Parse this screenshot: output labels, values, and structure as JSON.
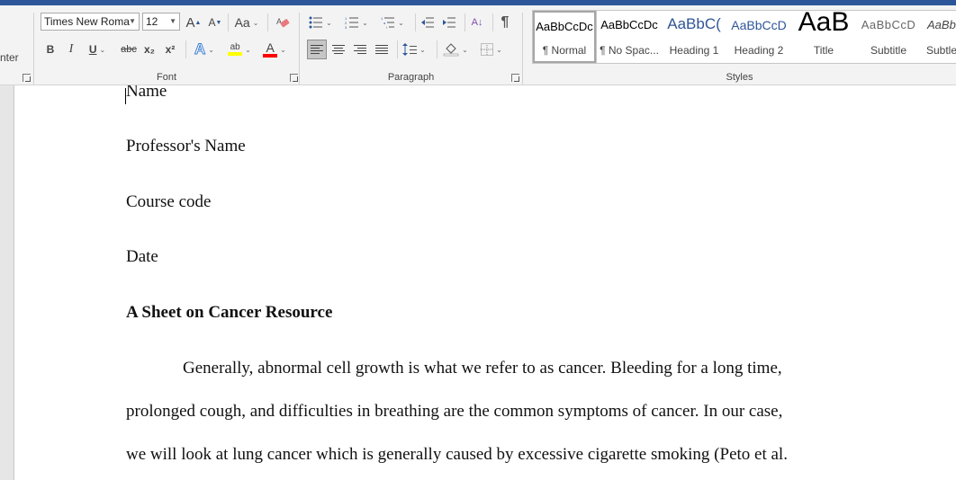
{
  "ribbon": {
    "clipboard": {
      "partial_label": "nter"
    },
    "font": {
      "label": "Font",
      "font_name": "Times New Roma",
      "font_size": "12",
      "grow_font": "A",
      "shrink_font": "A",
      "change_case": "Aa",
      "bold": "B",
      "italic": "I",
      "underline": "U",
      "strikethrough": "abc",
      "subscript": "x₂",
      "superscript": "x²",
      "text_effects": "A",
      "highlight": "ab",
      "font_color": "A",
      "highlight_color": "#ffff00",
      "font_color_value": "#ff0000"
    },
    "paragraph": {
      "label": "Paragraph",
      "sort": "A↓",
      "show_marks": "¶"
    },
    "styles": {
      "label": "Styles",
      "items": [
        {
          "preview": "AaBbCcDc",
          "name": "¶ Normal",
          "selected": true
        },
        {
          "preview": "AaBbCcDc",
          "name": "¶ No Spac..."
        },
        {
          "preview": "AaBbC(",
          "name": "Heading 1"
        },
        {
          "preview": "AaBbCcD",
          "name": "Heading 2"
        },
        {
          "preview": "AaB",
          "name": "Title"
        },
        {
          "preview": "AaBbCcD",
          "name": "Subtitle"
        },
        {
          "preview": "AaBb",
          "name": "Subtle"
        }
      ]
    }
  },
  "document": {
    "lines": [
      "Name",
      "Professor's Name",
      "Course code",
      "Date"
    ],
    "heading": "A Sheet on Cancer Resource",
    "paragraph_lines": [
      "Generally, abnormal cell growth is what we refer to as cancer. Bleeding for a long time,",
      "prolonged cough, and difficulties in breathing are the common symptoms of cancer. In our case,",
      "we will look at lung cancer which is generally caused by excessive cigarette smoking (Peto et al."
    ]
  }
}
